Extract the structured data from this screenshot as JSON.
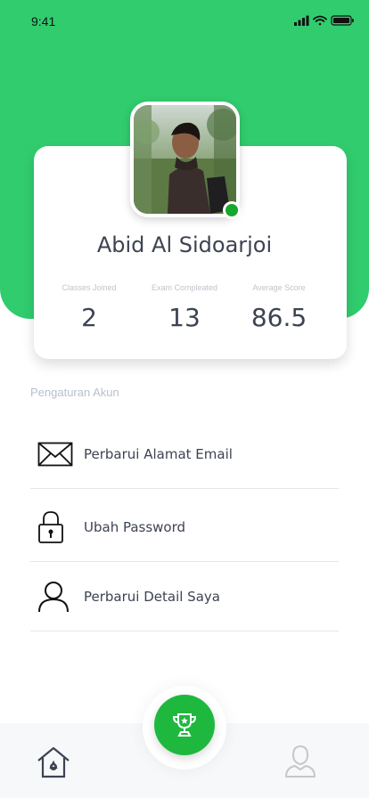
{
  "status_bar": {
    "time": "9:41"
  },
  "profile": {
    "name": "Abid Al Sidoarjoi",
    "online": true
  },
  "stats": [
    {
      "label": "Classes Joined",
      "value": "2"
    },
    {
      "label": "Exam Compleated",
      "value": "13"
    },
    {
      "label": "Average Score",
      "value": "86.5"
    }
  ],
  "settings": {
    "title": "Pengaturan Akun",
    "items": [
      {
        "label": "Perbarui Alamat Email",
        "icon": "envelope-icon"
      },
      {
        "label": "Ubah Password",
        "icon": "lock-icon"
      },
      {
        "label": "Perbarui Detail Saya",
        "icon": "user-icon"
      }
    ]
  },
  "bottom_nav": {
    "items": [
      {
        "icon": "home-icon"
      },
      {
        "icon": "trophy-icon",
        "active": true
      },
      {
        "icon": "profile-icon"
      }
    ]
  },
  "colors": {
    "primary_green": "#31cc6e",
    "fab_green": "#1fb83f",
    "online_green": "#14a82e",
    "text_dark": "#3d4352",
    "text_muted": "#b7c0cc"
  }
}
